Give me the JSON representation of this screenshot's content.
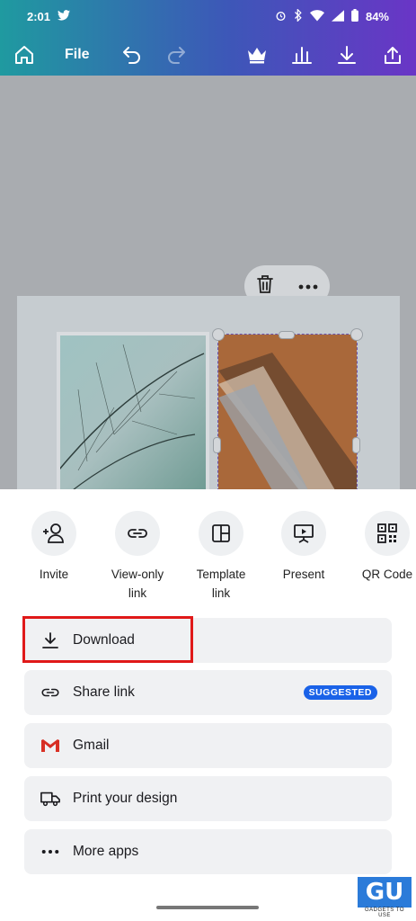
{
  "status_bar": {
    "time": "2:01",
    "battery": "84%"
  },
  "toolbar": {
    "file_label": "File"
  },
  "share_options": [
    {
      "label": "Invite",
      "icon": "invite-icon"
    },
    {
      "label": "View-only link",
      "icon": "link-icon"
    },
    {
      "label": "Template link",
      "icon": "template-icon"
    },
    {
      "label": "Present",
      "icon": "present-icon"
    },
    {
      "label": "QR Code",
      "icon": "qr-code-icon"
    }
  ],
  "actions": [
    {
      "label": "Download",
      "icon": "download-icon"
    },
    {
      "label": "Share link",
      "icon": "link-icon",
      "badge": "SUGGESTED"
    },
    {
      "label": "Gmail",
      "icon": "gmail-icon"
    },
    {
      "label": "Print your design",
      "icon": "truck-icon"
    },
    {
      "label": "More apps",
      "icon": "more-icon"
    }
  ],
  "watermark": {
    "logo": "GU",
    "text": "GADGETS TO USE"
  },
  "colors": {
    "badge": "#1a62e8",
    "highlight": "#e01919",
    "header_start": "#1f9aa0",
    "header_end": "#6a35c6"
  }
}
